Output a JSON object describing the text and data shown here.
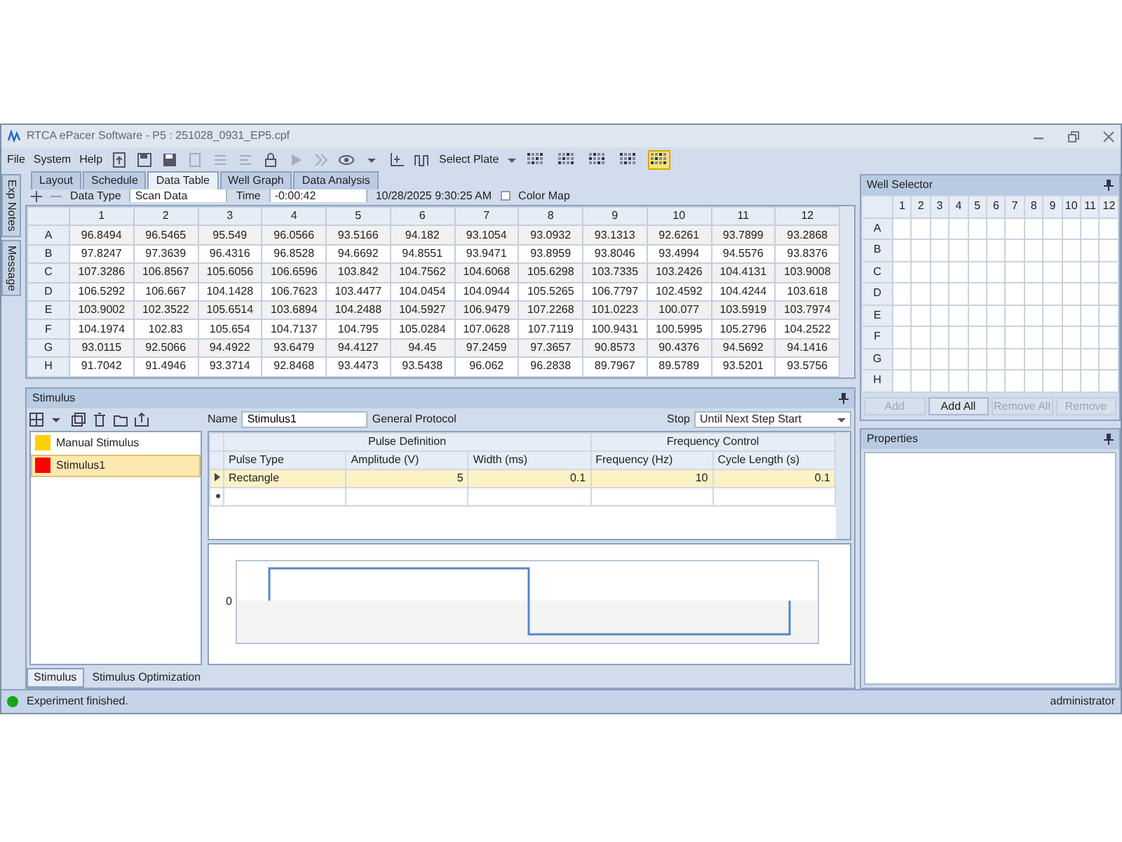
{
  "window": {
    "title": "RTCA ePacer Software - P5 : 251028_0931_EP5.cpf"
  },
  "menu": [
    "File",
    "System",
    "Help"
  ],
  "toolbar": {
    "select_plate": "Select Plate",
    "plate_buttons": [
      {
        "selected": false
      },
      {
        "selected": false
      },
      {
        "selected": false
      },
      {
        "selected": false
      },
      {
        "selected": true
      }
    ]
  },
  "side_tabs": [
    "Exp Notes",
    "Message"
  ],
  "tabs": [
    {
      "label": "Layout",
      "selected": false
    },
    {
      "label": "Schedule",
      "selected": false
    },
    {
      "label": "Data Table",
      "selected": true
    },
    {
      "label": "Well Graph",
      "selected": false
    },
    {
      "label": "Data Analysis",
      "selected": false
    }
  ],
  "filter": {
    "data_type_label": "Data Type",
    "data_type": "Scan Data",
    "time_label": "Time",
    "time": "-0:00:42",
    "timestamp": "10/28/2025 9:30:25 AM",
    "color_map": {
      "label": "Color Map",
      "checked": false
    }
  },
  "data_table": {
    "columns": [
      "1",
      "2",
      "3",
      "4",
      "5",
      "6",
      "7",
      "8",
      "9",
      "10",
      "11",
      "12"
    ],
    "rows": [
      {
        "label": "A",
        "values": [
          "96.8494",
          "96.5465",
          "95.549",
          "96.0566",
          "93.5166",
          "94.182",
          "93.1054",
          "93.0932",
          "93.1313",
          "92.6261",
          "93.7899",
          "93.2868"
        ]
      },
      {
        "label": "B",
        "values": [
          "97.8247",
          "97.3639",
          "96.4316",
          "96.8528",
          "94.6692",
          "94.8551",
          "93.9471",
          "93.8959",
          "93.8046",
          "93.4994",
          "94.5576",
          "93.8376"
        ]
      },
      {
        "label": "C",
        "values": [
          "107.3286",
          "106.8567",
          "105.6056",
          "106.6596",
          "103.842",
          "104.7562",
          "104.6068",
          "105.6298",
          "103.7335",
          "103.2426",
          "104.4131",
          "103.9008"
        ]
      },
      {
        "label": "D",
        "values": [
          "106.5292",
          "106.667",
          "104.1428",
          "106.7623",
          "103.4477",
          "104.0454",
          "104.0944",
          "105.5265",
          "106.7797",
          "102.4592",
          "104.4244",
          "103.618"
        ]
      },
      {
        "label": "E",
        "values": [
          "103.9002",
          "102.3522",
          "105.6514",
          "103.6894",
          "104.2488",
          "104.5927",
          "106.9479",
          "107.2268",
          "101.0223",
          "100.077",
          "103.5919",
          "103.7974"
        ]
      },
      {
        "label": "F",
        "values": [
          "104.1974",
          "102.83",
          "105.654",
          "104.7137",
          "104.795",
          "105.0284",
          "107.0628",
          "107.7119",
          "100.9431",
          "100.5995",
          "105.2796",
          "104.2522"
        ]
      },
      {
        "label": "G",
        "values": [
          "93.0115",
          "92.5066",
          "94.4922",
          "93.6479",
          "94.4127",
          "94.45",
          "97.2459",
          "97.3657",
          "90.8573",
          "90.4376",
          "94.5692",
          "94.1416"
        ]
      },
      {
        "label": "H",
        "values": [
          "91.7042",
          "91.4946",
          "93.3714",
          "92.8468",
          "93.4473",
          "93.5438",
          "96.062",
          "96.2838",
          "89.7967",
          "89.5789",
          "93.5201",
          "93.5756"
        ]
      }
    ]
  },
  "stimulus": {
    "title": "Stimulus",
    "list": [
      {
        "name": "Manual Stimulus",
        "color": "#ffd000",
        "selected": false
      },
      {
        "name": "Stimulus1",
        "color": "#ff0000",
        "selected": true
      }
    ],
    "name_label": "Name",
    "name": "Stimulus1",
    "protocol": "General Protocol",
    "stop_label": "Stop",
    "stop": "Until Next Step Start",
    "groups": [
      "Pulse Definition",
      "Frequency Control"
    ],
    "columns": [
      "Pulse Type",
      "Amplitude (V)",
      "Width (ms)",
      "Frequency (Hz)",
      "Cycle Length (s)"
    ],
    "rows": [
      {
        "values": [
          "Rectangle",
          "5",
          "0.1",
          "10",
          "0.1"
        ],
        "selected": true
      }
    ],
    "graph": {
      "y_label": "0"
    },
    "bottom_tabs": [
      {
        "label": "Stimulus",
        "selected": true
      },
      {
        "label": "Stimulus Optimization",
        "selected": false
      }
    ]
  },
  "well_selector": {
    "title": "Well Selector",
    "columns": [
      "1",
      "2",
      "3",
      "4",
      "5",
      "6",
      "7",
      "8",
      "9",
      "10",
      "11",
      "12"
    ],
    "rows": [
      "A",
      "B",
      "C",
      "D",
      "E",
      "F",
      "G",
      "H"
    ],
    "buttons": [
      {
        "label": "Add",
        "disabled": true
      },
      {
        "label": "Add All",
        "disabled": false
      },
      {
        "label": "Remove All",
        "disabled": true
      },
      {
        "label": "Remove",
        "disabled": true
      }
    ]
  },
  "properties": {
    "title": "Properties"
  },
  "status_bar": {
    "color": "#1aa31a",
    "message": "Experiment finished.",
    "user": "administrator"
  }
}
